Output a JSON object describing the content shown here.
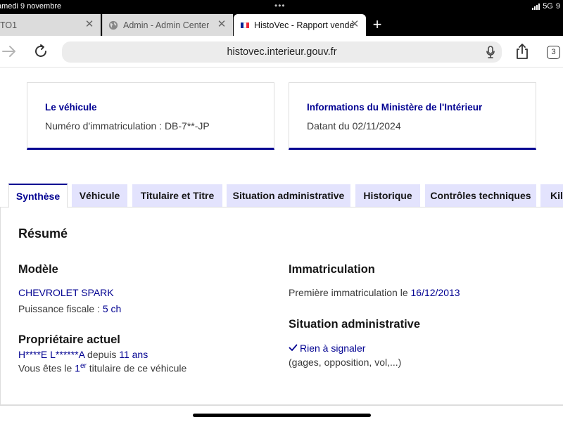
{
  "status_bar": {
    "date": "amedi 9 novembre",
    "network": "5G",
    "battery": "9"
  },
  "browser": {
    "tabs": [
      {
        "title": "TO1",
        "active": false
      },
      {
        "title": "Admin - Admin Center",
        "active": false
      },
      {
        "title": "HistoVec - Rapport vende",
        "active": true
      }
    ],
    "new_tab_label": "+",
    "url": "histovec.interieur.gouv.fr",
    "tab_count": "3"
  },
  "cards": {
    "vehicle": {
      "title": "Le véhicule",
      "text": "Numéro d'immatriculation : DB-7**-JP"
    },
    "ministry": {
      "title": "Informations du Ministère de l'Intérieur",
      "text": "Datant du 02/11/2024"
    }
  },
  "section_tabs": [
    {
      "label": "Synthèse",
      "active": true
    },
    {
      "label": "Véhicule",
      "active": false
    },
    {
      "label": "Titulaire et Titre",
      "active": false
    },
    {
      "label": "Situation administrative",
      "active": false
    },
    {
      "label": "Historique",
      "active": false
    },
    {
      "label": "Contrôles techniques",
      "active": false
    },
    {
      "label": "Kilo",
      "active": false
    }
  ],
  "summary": {
    "title": "Résumé",
    "model": {
      "heading": "Modèle",
      "name": "CHEVROLET SPARK",
      "power_label": "Puissance fiscale : ",
      "power_value": "5 ch"
    },
    "owner": {
      "heading": "Propriétaire actuel",
      "name": "H****E L******A",
      "since_label": " depuis ",
      "since_value": "11 ans",
      "rank_prefix": "Vous êtes le ",
      "rank_number": "1",
      "rank_sup": "er",
      "rank_suffix": " titulaire de ce véhicule"
    },
    "registration": {
      "heading": "Immatriculation",
      "label": "Première immatriculation le ",
      "date": "16/12/2013"
    },
    "admin": {
      "heading": "Situation administrative",
      "status": "Rien à signaler",
      "details": "(gages, opposition, vol,...)"
    }
  },
  "colors": {
    "accent": "#000091",
    "tab_bg": "#e3e3fd"
  }
}
